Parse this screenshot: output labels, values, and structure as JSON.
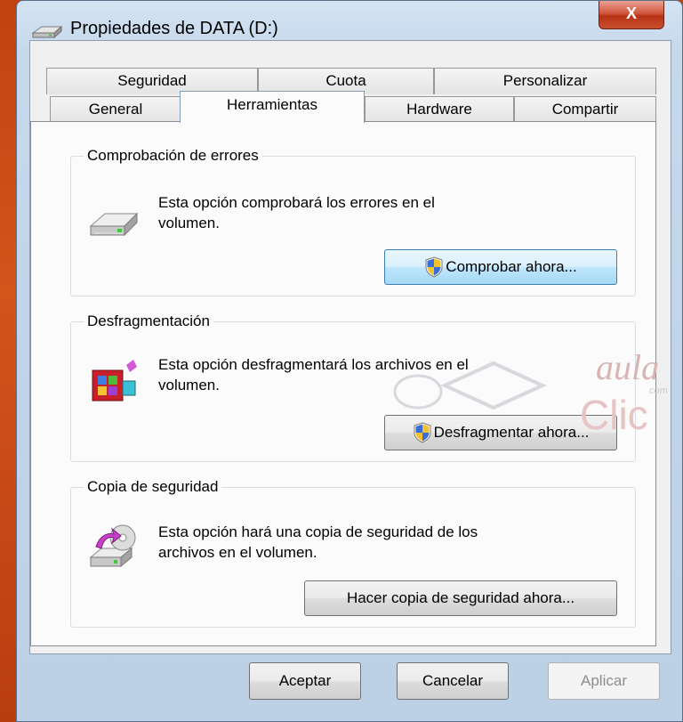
{
  "window": {
    "title": "Propiedades de DATA (D:)",
    "close_label": "X"
  },
  "tabs": {
    "row1": [
      "Seguridad",
      "Cuota",
      "Personalizar"
    ],
    "row2": [
      "General",
      "Herramientas",
      "Hardware",
      "Compartir"
    ],
    "active": "Herramientas"
  },
  "groups": [
    {
      "title": "Comprobación de errores",
      "description_line1": "Esta opción comprobará los errores en el",
      "description_line2": "volumen.",
      "button": "Comprobar ahora...",
      "icon": "hard-drive-icon"
    },
    {
      "title": "Desfragmentación",
      "description_line1": "Esta opción desfragmentará los archivos en el",
      "description_line2": "volumen.",
      "button": "Desfragmentar ahora...",
      "icon": "defragment-icon"
    },
    {
      "title": "Copia de seguridad",
      "description_line1": "Esta opción hará una copia de seguridad de los",
      "description_line2": "archivos en el volumen.",
      "button": "Hacer copia de seguridad ahora...",
      "icon": "backup-icon"
    }
  ],
  "footer": {
    "ok": "Aceptar",
    "cancel": "Cancelar",
    "apply": "Aplicar"
  },
  "watermark": {
    "line1": "aula",
    "line2": "Clic",
    "small": "com"
  },
  "colors": {
    "focus_border": "#3c7fb1",
    "watermark": "#d9b4b4",
    "window_frame": "#c5d8ec"
  }
}
